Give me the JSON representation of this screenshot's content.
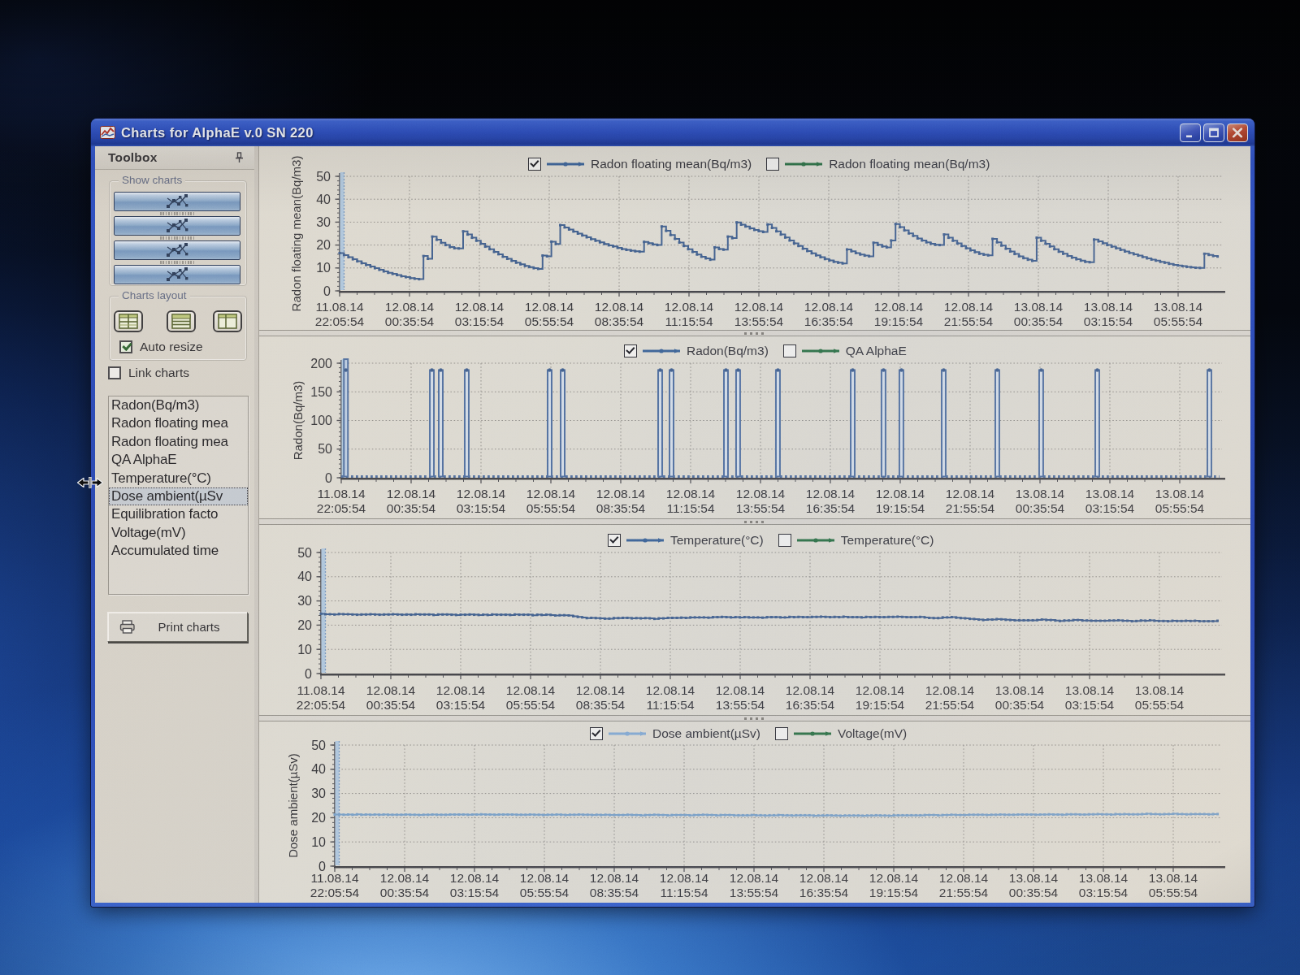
{
  "window": {
    "title": "Charts for AlphaE v.0 SN 220",
    "buttons": {
      "minimize": "minimize",
      "maximize": "maximize",
      "close": "close"
    }
  },
  "toolbox": {
    "header": "Toolbox",
    "show_charts_label": "Show charts",
    "charts_layout_label": "Charts layout",
    "auto_resize_label": "Auto resize",
    "auto_resize_checked": true,
    "link_charts_label": "Link charts",
    "link_charts_checked": false,
    "show_chart_buttons": [
      "show-chart-1",
      "show-chart-2",
      "show-chart-3",
      "show-chart-4"
    ],
    "layout_buttons": [
      "layout-grid",
      "layout-rows",
      "layout-columns"
    ],
    "list_items": [
      "Radon(Bq/m3)",
      "Radon floating mea",
      "Radon floating mea",
      "QA AlphaE",
      "Temperature(°C)",
      "Dose ambient(µSv",
      "Equilibration facto",
      "Voltage(mV)",
      "Accumulated time"
    ],
    "selected_item_index": 5,
    "print_button": "Print charts"
  },
  "axis": {
    "dates": [
      "11.08.14",
      "12.08.14",
      "12.08.14",
      "12.08.14",
      "12.08.14",
      "12.08.14",
      "12.08.14",
      "12.08.14",
      "12.08.14",
      "12.08.14",
      "13.08.14",
      "13.08.14",
      "13.08.14"
    ],
    "times": [
      "22:05:54",
      "00:35:54",
      "03:15:54",
      "05:55:54",
      "08:35:54",
      "11:15:54",
      "13:55:54",
      "16:35:54",
      "19:15:54",
      "21:55:54",
      "00:35:54",
      "03:15:54",
      "05:55:54"
    ]
  },
  "colors": {
    "series_blue": "#2f5c96",
    "series_blue_light": "#7aa6d4",
    "legend_green": "#1e6b38",
    "titlebar_blue": "#2b50c8",
    "close_red": "#c03a24",
    "window_gray": "#d6d2c9"
  },
  "chart_data": [
    {
      "type": "line",
      "name": "radon-floating-mean",
      "legend": [
        {
          "label": "Radon floating mean(Bq/m3)",
          "checked": true,
          "color": "#2f5c96"
        },
        {
          "label": "Radon floating mean(Bq/m3)",
          "checked": false,
          "color": "#1e6b38"
        }
      ],
      "ylabel": "Radon floating mean(Bq/m3)",
      "ylim": [
        0,
        50
      ],
      "yticks": [
        0,
        10,
        20,
        30,
        40,
        50
      ],
      "first_point_clipped": true,
      "x_end": 0.995,
      "values": [
        16.5,
        15.6,
        14.7,
        13.8,
        12.9,
        12.1,
        11.3,
        10.6,
        9.9,
        9.2,
        8.5,
        7.9,
        7.4,
        6.9,
        6.4,
        6.0,
        5.6,
        5.3,
        5.1,
        15.2,
        14.0,
        23.7,
        22.3,
        21.0,
        20.0,
        19.1,
        18.6,
        18.5,
        26.0,
        24.6,
        23.2,
        21.9,
        20.6,
        19.3,
        18.2,
        17.0,
        16.0,
        14.9,
        14.0,
        13.1,
        12.3,
        11.6,
        10.9,
        10.4,
        9.9,
        9.6,
        15.4,
        15.1,
        21.5,
        20.5,
        28.7,
        27.7,
        26.8,
        25.9,
        25.0,
        24.2,
        23.4,
        22.6,
        21.9,
        21.2,
        20.5,
        19.9,
        19.4,
        18.8,
        18.3,
        17.9,
        17.6,
        17.3,
        17.1,
        21.4,
        20.8,
        20.3,
        20.0,
        28.1,
        26.2,
        24.4,
        22.7,
        21.1,
        19.6,
        18.2,
        17.0,
        15.9,
        14.9,
        14.2,
        13.6,
        19.0,
        18.3,
        18.0,
        23.7,
        23.0,
        29.9,
        28.9,
        28.1,
        27.3,
        26.6,
        26.1,
        25.7,
        29.0,
        27.5,
        26.0,
        24.6,
        23.3,
        22.0,
        20.7,
        19.6,
        18.4,
        17.4,
        16.4,
        15.5,
        14.7,
        13.9,
        13.3,
        12.7,
        12.3,
        12.0,
        18.1,
        17.3,
        16.5,
        15.9,
        15.4,
        15.1,
        21.0,
        20.1,
        19.4,
        19.0,
        22.0,
        29.2,
        27.8,
        26.4,
        25.1,
        24.0,
        22.9,
        22.0,
        21.2,
        20.6,
        20.1,
        20.0,
        24.6,
        23.2,
        21.9,
        20.7,
        19.6,
        18.6,
        17.7,
        16.9,
        16.2,
        15.8,
        15.5,
        22.7,
        21.2,
        19.8,
        18.4,
        17.2,
        16.1,
        15.1,
        14.3,
        13.6,
        13.1,
        23.2,
        21.9,
        20.6,
        19.4,
        18.2,
        17.1,
        16.2,
        15.3,
        14.5,
        13.8,
        13.2,
        12.7,
        12.5,
        22.4,
        21.6,
        20.8,
        20.0,
        19.3,
        18.6,
        17.9,
        17.2,
        16.6,
        16.0,
        15.4,
        14.8,
        14.2,
        13.7,
        13.2,
        12.7,
        12.3,
        11.8,
        11.4,
        11.1,
        10.8,
        10.5,
        10.3,
        10.1,
        10.0,
        16.2,
        15.7,
        15.2,
        15.0
      ]
    },
    {
      "type": "line",
      "name": "radon",
      "legend": [
        {
          "label": "Radon(Bq/m3)",
          "checked": true,
          "color": "#2f5c96"
        },
        {
          "label": "QA AlphaE",
          "checked": false,
          "color": "#1e6b38"
        }
      ],
      "ylabel": "Radon(Bq/m3)",
      "ylim": [
        0,
        200
      ],
      "yticks": [
        0,
        50,
        100,
        150,
        200
      ],
      "first_point_clipped": true,
      "baseline": 0,
      "spike_value": 188,
      "spike_width": 0.0046,
      "spikes": [
        0.003,
        0.1006,
        0.1107,
        0.1402,
        0.2343,
        0.2491,
        0.3598,
        0.3727,
        0.4345,
        0.4483,
        0.4935,
        0.5784,
        0.6134,
        0.6337,
        0.6817,
        0.7426,
        0.7924,
        0.8561,
        0.9834
      ]
    },
    {
      "type": "line",
      "name": "temperature",
      "legend": [
        {
          "label": "Temperature(°C)",
          "checked": true,
          "color": "#2f5c96"
        },
        {
          "label": "Temperature(°C)",
          "checked": false,
          "color": "#1e6b38"
        }
      ],
      "ylabel": "",
      "ylim": [
        0,
        50
      ],
      "yticks": [
        0,
        10,
        20,
        30,
        40,
        50
      ],
      "first_point_clipped": true,
      "x_end": 0.995,
      "values": [
        24.7,
        24.5,
        24.5,
        24.4,
        24.6,
        24.5,
        24.5,
        24.4,
        24.3,
        24.4,
        24.4,
        24.5,
        24.4,
        24.3,
        24.4,
        24.4,
        24.5,
        24.4,
        24.3,
        24.4,
        24.3,
        24.5,
        24.4,
        24.4,
        24.4,
        24.2,
        24.4,
        24.4,
        24.4,
        24.3,
        24.2,
        24.3,
        24.3,
        24.4,
        24.3,
        24.2,
        24.3,
        24.2,
        24.4,
        24.3,
        24.3,
        24.3,
        24.2,
        24.4,
        24.3,
        24.3,
        24.3,
        24.1,
        24.3,
        24.2,
        24.3,
        24.2,
        24.0,
        24.1,
        24.1,
        24.0,
        23.7,
        23.4,
        23.2,
        22.9,
        23.0,
        22.9,
        22.8,
        22.7,
        22.7,
        22.9,
        22.9,
        23.0,
        23.0,
        22.8,
        22.9,
        22.8,
        22.9,
        22.8,
        22.6,
        22.8,
        22.8,
        23.0,
        23.0,
        23.0,
        23.1,
        23.0,
        23.2,
        23.2,
        23.2,
        23.2,
        23.1,
        23.3,
        23.3,
        23.4,
        23.3,
        23.2,
        23.3,
        23.2,
        23.3,
        23.2,
        23.2,
        23.2,
        23.1,
        23.3,
        23.3,
        23.3,
        23.2,
        23.2,
        23.4,
        23.3,
        23.4,
        23.3,
        23.3,
        23.4,
        23.4,
        23.5,
        23.4,
        23.3,
        23.4,
        23.3,
        23.5,
        23.3,
        23.3,
        23.3,
        23.2,
        23.4,
        23.3,
        23.4,
        23.3,
        23.3,
        23.4,
        23.4,
        23.5,
        23.4,
        23.3,
        23.3,
        23.3,
        23.4,
        23.2,
        23.0,
        22.9,
        22.9,
        23.2,
        23.2,
        23.3,
        23.1,
        22.9,
        22.8,
        22.6,
        22.5,
        22.3,
        22.1,
        22.3,
        22.3,
        22.5,
        22.4,
        22.2,
        22.1,
        22.0,
        22.0,
        22.0,
        22.0,
        22.0,
        22.1,
        22.3,
        22.1,
        22.1,
        21.9,
        21.7,
        21.9,
        21.9,
        22.1,
        22.1,
        21.9,
        21.9,
        21.8,
        21.8,
        21.8,
        21.8,
        21.9,
        21.9,
        22.0,
        21.8,
        21.8,
        21.6,
        21.7,
        21.9,
        21.8,
        22.0,
        21.8,
        21.7,
        21.7,
        21.6,
        21.8,
        21.7,
        21.7,
        21.8,
        21.7,
        21.8,
        21.6,
        21.6,
        21.6,
        21.6,
        21.8
      ]
    },
    {
      "type": "line",
      "name": "dose-ambient",
      "legend": [
        {
          "label": "Dose ambient(µSv)",
          "checked": true,
          "color": "#7aa6d4"
        },
        {
          "label": "Voltage(mV)",
          "checked": false,
          "color": "#1e6b38"
        }
      ],
      "ylabel": "Dose ambient(µSv)",
      "ylim": [
        0,
        50
      ],
      "yticks": [
        0,
        10,
        20,
        30,
        40,
        50
      ],
      "first_point_clipped": true,
      "x_end": 0.995,
      "values": [
        21.3,
        21.3,
        21.2,
        21.3,
        21.2,
        21.4,
        21.2,
        21.3,
        21.2,
        21.3,
        21.2,
        21.3,
        21.2,
        21.2,
        21.2,
        21.2,
        21.3,
        21.2,
        21.2,
        21.1,
        21.2,
        21.2,
        21.3,
        21.2,
        21.2,
        21.2,
        21.3,
        21.3,
        21.3,
        21.3,
        21.2,
        21.3,
        21.3,
        21.4,
        21.3,
        21.3,
        21.2,
        21.3,
        21.3,
        21.3,
        21.3,
        21.2,
        21.2,
        21.2,
        21.3,
        21.2,
        21.2,
        21.1,
        21.2,
        21.2,
        21.3,
        21.2,
        21.1,
        21.2,
        21.2,
        21.3,
        21.2,
        21.2,
        21.1,
        21.2,
        21.1,
        21.2,
        21.1,
        21.1,
        21.1,
        21.1,
        21.2,
        21.1,
        21.1,
        21.0,
        21.1,
        21.1,
        21.2,
        21.1,
        21.1,
        21.0,
        21.1,
        21.1,
        21.1,
        21.1,
        21.0,
        21.1,
        21.1,
        21.2,
        21.1,
        21.1,
        21.0,
        21.1,
        21.1,
        21.1,
        21.0,
        21.0,
        21.0,
        21.0,
        21.1,
        21.0,
        21.0,
        20.9,
        21.0,
        21.0,
        21.1,
        21.0,
        21.0,
        20.9,
        21.0,
        21.0,
        21.0,
        21.0,
        20.8,
        20.9,
        20.9,
        21.0,
        20.9,
        20.9,
        20.8,
        20.9,
        20.9,
        20.9,
        20.9,
        20.8,
        20.9,
        20.9,
        21.0,
        20.9,
        20.9,
        20.8,
        21.0,
        21.0,
        21.0,
        21.0,
        21.0,
        21.0,
        21.0,
        21.1,
        21.1,
        21.1,
        21.0,
        21.1,
        21.1,
        21.2,
        21.1,
        21.1,
        21.1,
        21.2,
        21.2,
        21.2,
        21.2,
        21.1,
        21.2,
        21.2,
        21.3,
        21.2,
        21.2,
        21.2,
        21.3,
        21.3,
        21.3,
        21.3,
        21.2,
        21.3,
        21.3,
        21.4,
        21.3,
        21.3,
        21.2,
        21.4,
        21.4,
        21.4,
        21.3,
        21.3,
        21.4,
        21.4,
        21.5,
        21.4,
        21.4,
        21.3,
        21.5,
        21.4,
        21.5,
        21.4,
        21.4,
        21.4,
        21.5,
        21.6,
        21.5,
        21.5,
        21.4,
        21.5,
        21.5,
        21.6,
        21.5,
        21.5,
        21.4,
        21.5,
        21.5,
        21.5,
        21.5,
        21.4,
        21.5,
        21.5
      ]
    }
  ]
}
